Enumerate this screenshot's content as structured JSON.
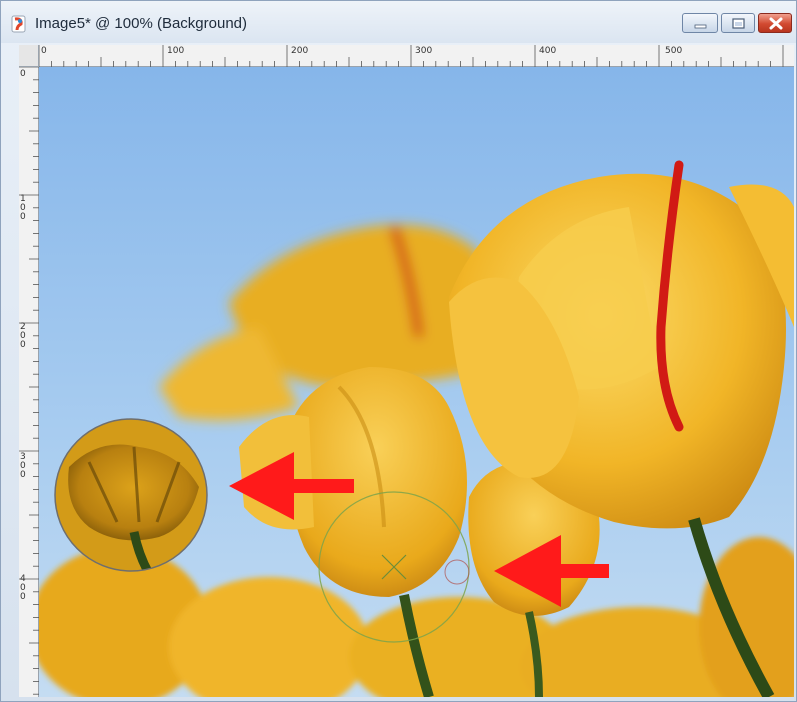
{
  "window": {
    "title": "Image5* @ 100% (Background)",
    "buttons": {
      "minimize": "minimize",
      "maximize": "maximize",
      "close": "close"
    }
  },
  "rulers": {
    "top_labels": [
      "0",
      "100",
      "200",
      "300",
      "400",
      "500"
    ],
    "left_labels": [
      "0",
      "100",
      "200",
      "300",
      "400"
    ]
  },
  "canvas": {
    "subject": "yellow tulips against a blue sky",
    "colors": {
      "sky": "#9fc6ee",
      "petal": "#f0b82a",
      "stem": "#2d4a17",
      "arrow": "#ff1a1a",
      "red_streak": "#d11a14"
    },
    "arrows": [
      "red-arrow-upper",
      "red-arrow-lower"
    ],
    "circles": [
      "magnified-lens-circle",
      "brush-cursor-circle"
    ]
  }
}
